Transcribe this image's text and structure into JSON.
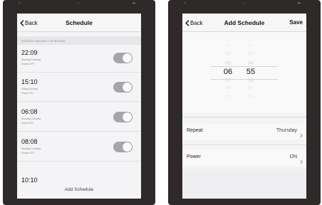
{
  "left_screen": {
    "status": {
      "carrier": "••",
      "time": "—",
      "battery": "▬"
    },
    "nav": {
      "back_label": "Back",
      "title": "Schedule"
    },
    "notice": "Schedule executes ± 30 seconds",
    "schedules": [
      {
        "time": "22:09",
        "days": "Monday,Tuesday",
        "power": "Power:OFF",
        "enabled": true
      },
      {
        "time": "15:10",
        "days": "Friday,Sunday",
        "power": "Power:ON",
        "enabled": true
      },
      {
        "time": "06:08",
        "days": "Monday,Tuesday",
        "power": "Power:ON",
        "enabled": true
      },
      {
        "time": "08:08",
        "days": "Monday,Tuesday",
        "power": "Power:OFF",
        "enabled": true
      }
    ],
    "last_time": "10:10",
    "add_label": "Add Schedule"
  },
  "right_screen": {
    "status": {
      "carrier": "••",
      "time": "—",
      "battery": "▬"
    },
    "nav": {
      "back_label": "Back",
      "title": "Add Schedule",
      "save_label": "Save"
    },
    "picker": {
      "hours": [
        "03",
        "04",
        "05",
        "06",
        "07",
        "08",
        "09"
      ],
      "minutes": [
        "52",
        "53",
        "54",
        "55",
        "56",
        "57",
        "58"
      ],
      "selected_index": 3
    },
    "repeat": {
      "label": "Repeat",
      "value": "Thursday"
    },
    "power": {
      "label": "Power",
      "value": "ON"
    }
  }
}
